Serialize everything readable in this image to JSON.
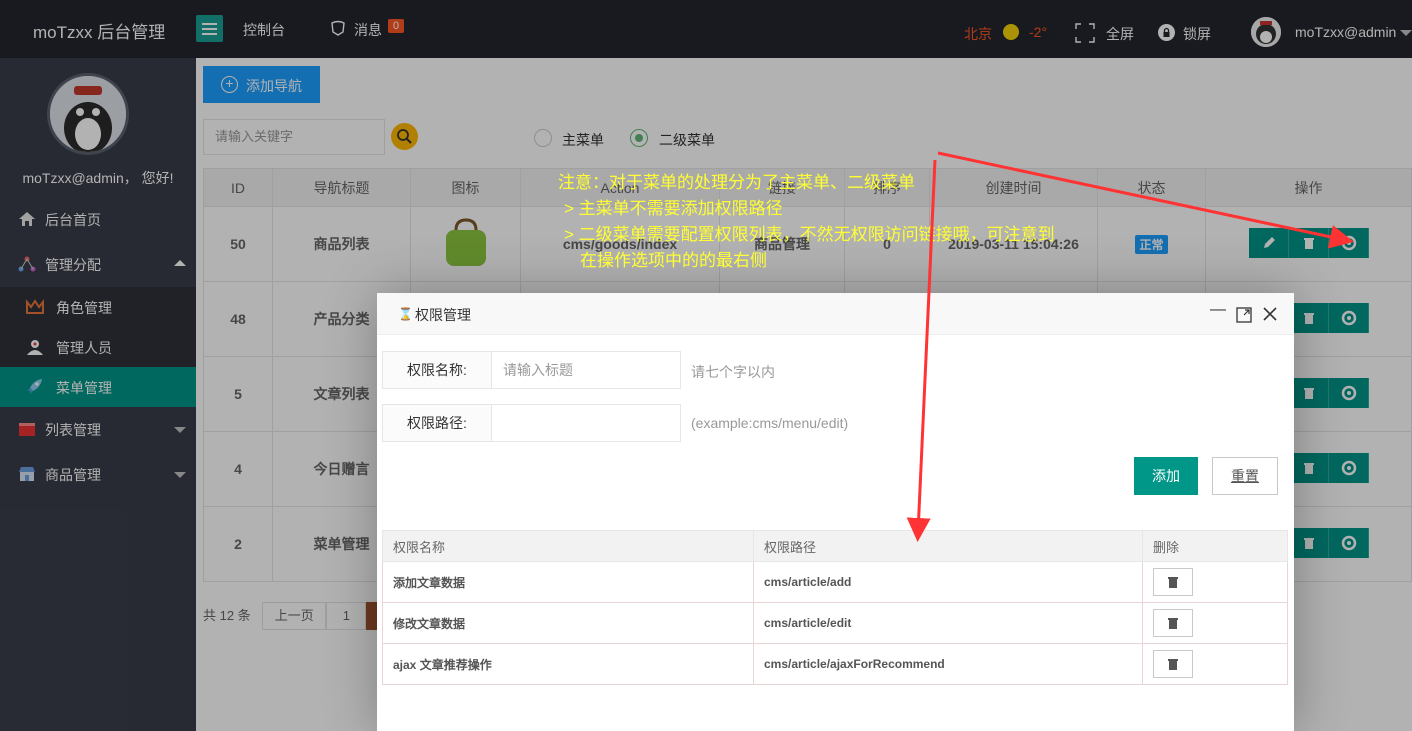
{
  "header": {
    "logo": "moTzxx 后台管理",
    "console": "控制台",
    "messages_label": "消息",
    "messages_count": "0",
    "city": "北京",
    "temperature": "-2°",
    "fullscreen": "全屏",
    "lockscreen": "锁屏",
    "user": "moTzxx@admin"
  },
  "sidebar": {
    "greeting": "moTzxx@admin， 您好!",
    "items": [
      {
        "label": "后台首页"
      },
      {
        "label": "管理分配"
      },
      {
        "label": "角色管理"
      },
      {
        "label": "管理人员"
      },
      {
        "label": "菜单管理"
      },
      {
        "label": "列表管理"
      },
      {
        "label": "商品管理"
      }
    ]
  },
  "main": {
    "add_nav_button": "添加导航",
    "search_placeholder": "请输入关键字",
    "radio_main": "主菜单",
    "radio_sub": "二级菜单",
    "columns": [
      "ID",
      "导航标题",
      "图标",
      "Action",
      "链接",
      "排序",
      "创建时间",
      "状态",
      "操作"
    ],
    "rows": [
      {
        "id": "50",
        "title": "商品列表",
        "action": "cms/goods/index",
        "link": "商品管理",
        "sort": "0",
        "created": "2019-03-11 15:04:26",
        "status": "正常"
      },
      {
        "id": "48",
        "title": "产品分类",
        "action": "",
        "link": "",
        "sort": "",
        "created": "",
        "status": ""
      },
      {
        "id": "5",
        "title": "文章列表",
        "action": "",
        "link": "",
        "sort": "",
        "created": "",
        "status": ""
      },
      {
        "id": "4",
        "title": "今日赠言",
        "action": "",
        "link": "",
        "sort": "",
        "created": "",
        "status": ""
      },
      {
        "id": "2",
        "title": "菜单管理",
        "action": "",
        "link": "",
        "sort": "",
        "created": "",
        "status": ""
      }
    ],
    "pager_total": "共 12 条",
    "pager_prev": "上一页",
    "pager_page": "1"
  },
  "dialog": {
    "title": "权限管理",
    "name_label": "权限名称:",
    "name_placeholder": "请输入标题",
    "name_tip": "请七个字以内",
    "path_label": "权限路径:",
    "path_value": "",
    "path_tip": "(example:cms/menu/edit)",
    "add_button": "添加",
    "reset_button": "重置",
    "table_headers": [
      "权限名称",
      "权限路径",
      "删除"
    ],
    "permissions": [
      {
        "name": "添加文章数据",
        "path": "cms/article/add"
      },
      {
        "name": "修改文章数据",
        "path": "cms/article/edit"
      },
      {
        "name": "ajax 文章推荐操作",
        "path": "cms/article/ajaxForRecommend"
      }
    ]
  },
  "annotation": {
    "line1": "注意：对于菜单的处理分为了主菜单、二级菜单",
    "line2": "> 主菜单不需要添加权限路径",
    "line3": "> 二级菜单需要配置权限列表，不然无权限访问链接哦，可注意到",
    "line4": "在操作选项中的的最右侧"
  },
  "colors": {
    "header_bg": "#23262e",
    "sidebar_bg": "#393d49",
    "accent": "#009688",
    "primary": "#1e9fff",
    "annotation": "#ffff33",
    "arrow": "#ff3333"
  }
}
